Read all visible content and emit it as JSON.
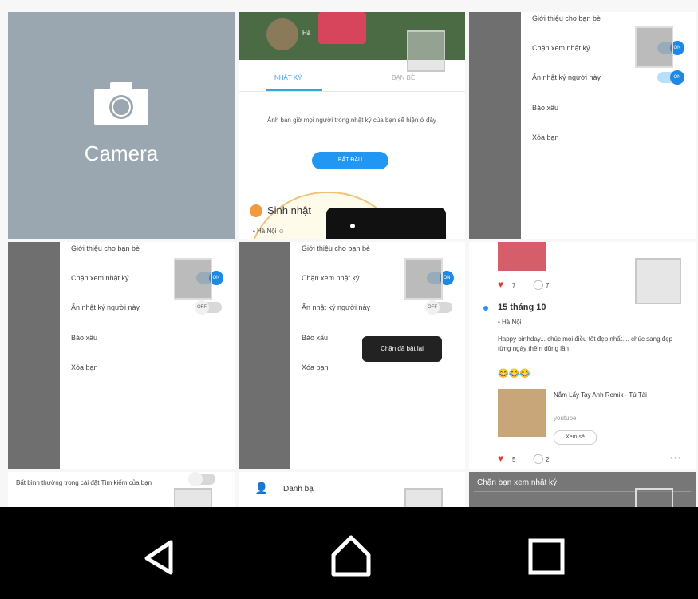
{
  "camera_tile": {
    "label": "Camera"
  },
  "tile2": {
    "header_name": "Hà",
    "tab_left": "NHẬT KÝ",
    "tab_right": "BẠN BÈ",
    "intro_text": "Ảnh bạn giờ mọi người trong nhật ký của bạn sẽ hiện ở đây",
    "button_label": "BẮT ĐẦU",
    "birthday_label": "Sinh nhật",
    "birthday_sub": "•  Hà Nội   ☺  "
  },
  "settings_menu": {
    "items": [
      "Giới thiệu cho bạn bè",
      "Chặn xem nhật ký",
      "Ẩn nhật ký người này",
      "Báo xấu",
      "Xóa bạn"
    ],
    "toggle_on": "ON",
    "toggle_off": "OFF"
  },
  "tile5": {
    "toast": "Chặn đã bật lại"
  },
  "tile6": {
    "likes1": "7",
    "comments1": "7",
    "date": "15 tháng 10",
    "sub": "• Hà Nội",
    "post_text": "Happy birthday... chúc mọi điều tốt đẹp nhất.... chúc sang đẹp từng ngày thêm dũng lần",
    "emojis": "😂😂😂",
    "link_title": "Nắm Lấy Tay Anh Remix - Tú Tài",
    "link_source": "youtube",
    "link_btn": "Xem sẽ",
    "likes2": "5",
    "comments2": "2",
    "more": "• • •"
  },
  "tile7": {
    "text": "Bất bình thường trong cài đặt Tìm kiếm của bạn"
  },
  "tile8": {
    "label": "Danh bạ"
  },
  "tile9": {
    "label": "Chặn bạn xem nhật ký"
  },
  "nav": {
    "back_icon": "back-triangle",
    "home_icon": "home",
    "recents_icon": "recents-square"
  }
}
